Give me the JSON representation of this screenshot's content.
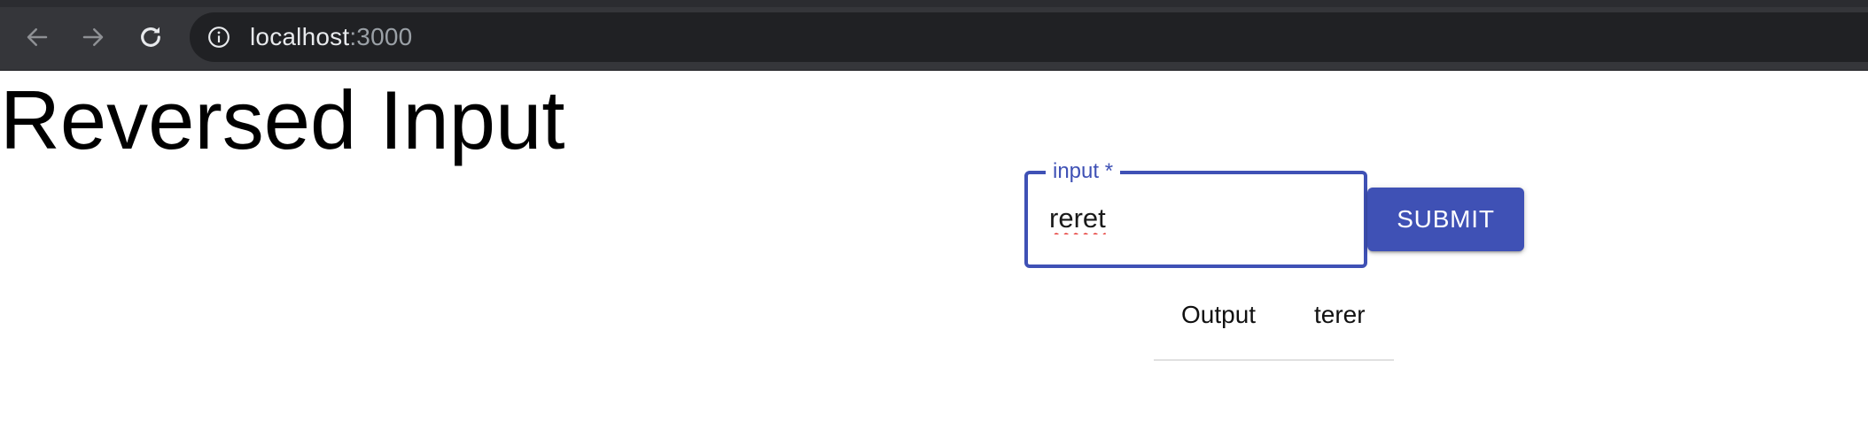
{
  "browser": {
    "url_host": "localhost",
    "url_port": ":3000",
    "icons": {
      "back": "arrow-left-icon",
      "forward": "arrow-right-icon",
      "reload": "reload-icon",
      "site_info": "info-icon"
    },
    "colors": {
      "toolbar_bg": "#35363a",
      "omnibox_bg": "#202124",
      "url_text": "#e8eaed",
      "url_muted": "#9aa0a6"
    }
  },
  "page": {
    "title": "Reversed Input",
    "form": {
      "input_label": "input *",
      "input_value": "reret",
      "submit_label": "SUBMIT"
    },
    "output": {
      "label": "Output",
      "value": "terer"
    },
    "colors": {
      "primary": "#3f51b5",
      "spellcheck_underline": "#e53935",
      "divider": "#e0e0e0"
    }
  }
}
